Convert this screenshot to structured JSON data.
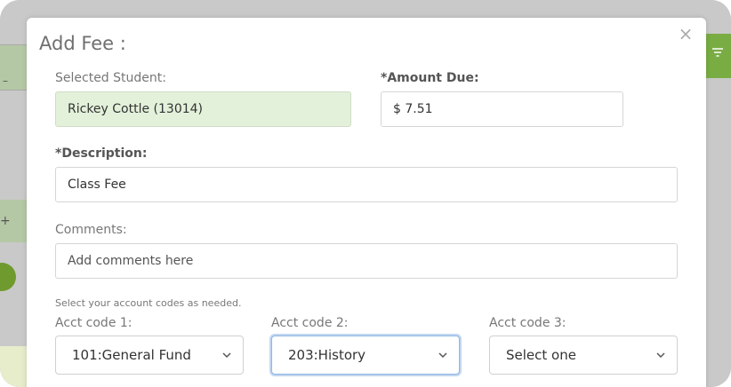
{
  "modal": {
    "title": "Add Fee :",
    "close_glyph": "×"
  },
  "selected_student": {
    "label": "Selected Student:",
    "value": "Rickey Cottle (13014)"
  },
  "amount_due": {
    "label": "*Amount Due:",
    "value": "$ 7.51"
  },
  "description": {
    "label": "*Description:",
    "value": "Class Fee"
  },
  "comments": {
    "label": "Comments:",
    "placeholder": "Add comments here"
  },
  "account_codes": {
    "hint": "Select your account codes as needed.",
    "codes": [
      {
        "label": "Acct code 1:",
        "selected": "101:General Fund"
      },
      {
        "label": "Acct code 2:",
        "selected": "203:History"
      },
      {
        "label": "Acct code 3:",
        "selected": "Select one"
      }
    ]
  },
  "icons": {
    "close": "close-icon",
    "chevron": "chevron-down-icon",
    "filter": "filter-icon"
  },
  "colors": {
    "readonly_bg": "#e3f1da",
    "focus_ring": "#8fb6e3",
    "accent_green": "#79ad43"
  }
}
